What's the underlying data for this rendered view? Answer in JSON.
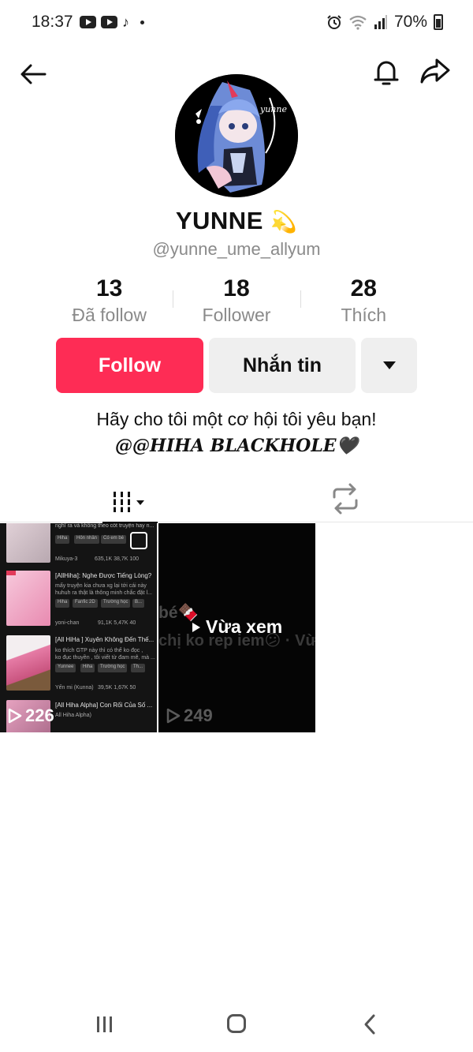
{
  "status_bar": {
    "time": "18:37",
    "tiktok_glyph": "♪",
    "battery": "70%"
  },
  "profile": {
    "display_name": "YUNNE",
    "name_emoji": "💫",
    "handle": "@yunne_ume_allyum",
    "avatar_text": "yunne"
  },
  "stats": [
    {
      "value": "13",
      "label": "Đã follow"
    },
    {
      "value": "18",
      "label": "Follower"
    },
    {
      "value": "28",
      "label": "Thích"
    }
  ],
  "actions": {
    "follow_label": "Follow",
    "message_label": "Nhắn tin"
  },
  "bio": {
    "line1": "Hãy cho tôi một cơ hội tôi yêu bạn!",
    "line2": "@@HIHA BLACKHOLE🖤"
  },
  "videos": [
    {
      "views": "226",
      "thumbnail_text": {
        "top_snippet": "nghĩ ra và không theo cốt truyện hay n...",
        "top_tags": [
          "Hiha",
          "Hôn nhân",
          "Có em bé"
        ],
        "top_author": "Mikuya-3",
        "top_meta": "635,1K   38,7K   100",
        "item1_title": "[AllHiha]: Nghe Được Tiếng Lòng?",
        "item1_desc1": "mấy truyện kia chưa xg lại tới cái này",
        "item1_desc2": "huhuh ra thật là thông minh chắc đặt l...",
        "item1_tags": [
          "Hiha",
          "Fanfic 2D",
          "Trường học",
          "B..."
        ],
        "item1_author": "yoni-chan",
        "item1_meta": "91,1K   5,47K   40",
        "item2_title": "[All HiHa ] Xuyên Không Đến Thế...",
        "item2_desc1": "ko thích GTP này thì có thể ko đọc ,",
        "item2_desc2": "ko đục thuyền , tôi viết từ đam mê, mà ...",
        "item2_tags": [
          "Yunnee",
          "Hiha",
          "Trường học",
          "Th..."
        ],
        "item2_author": "Yến mi (Kunna)",
        "item2_meta": "39,5K   1,67K   50",
        "item3_title": "[All Hiha Alpha] Con Rối Của Số ...",
        "item3_desc": "All Hiha Alpha)"
      }
    },
    {
      "views": "249",
      "watched_label": "Vừa xem",
      "thumbnail_text": {
        "faded_line1": "bé🍫",
        "faded_line2": "chị ko rep iem😕 · Vừ"
      }
    }
  ],
  "icons": {
    "back": "arrow-left",
    "bell": "bell-outline",
    "share": "share-arrow",
    "more": "caret-down",
    "videos_tab": "grid-bars",
    "repost_tab": "repost-arrows"
  },
  "colors": {
    "follow": "#fe2c55",
    "secondary_button": "#efefef",
    "muted_text": "#8a8a8a"
  }
}
